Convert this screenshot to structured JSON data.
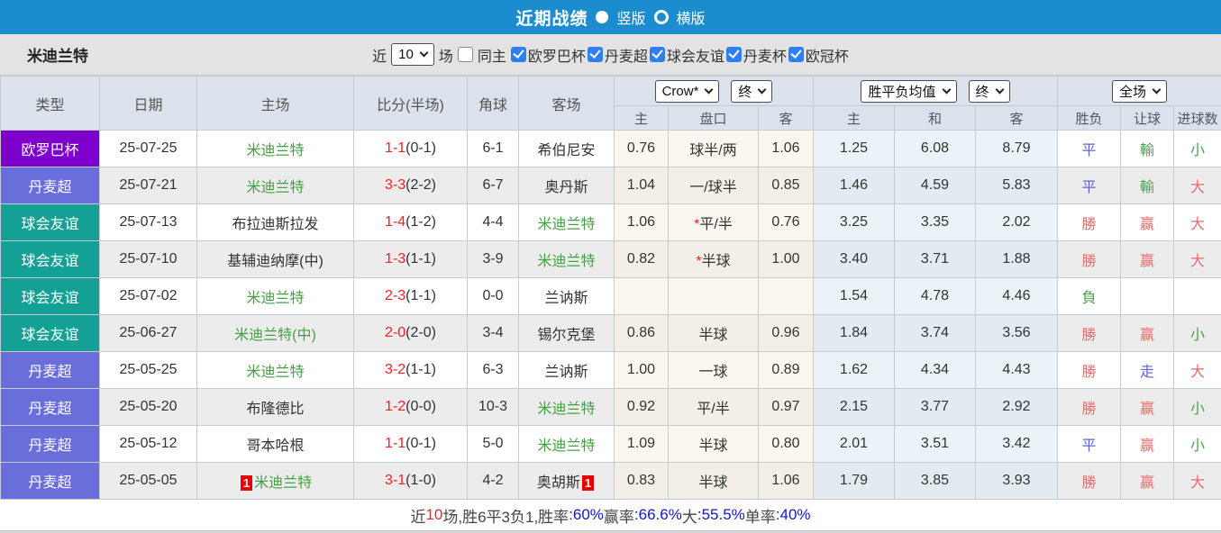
{
  "titlebar": {
    "title": "近期战绩",
    "radio_vertical": "竖版",
    "radio_horizontal": "横版"
  },
  "filterbar": {
    "team": "米迪兰特",
    "near_label": "近",
    "matches_select": "10",
    "matches_label": "场",
    "same_home_label": "同主",
    "same_home_checked": false,
    "leagues": [
      {
        "label": "欧罗巴杯",
        "checked": true
      },
      {
        "label": "丹麦超",
        "checked": true
      },
      {
        "label": "球会友谊",
        "checked": true
      },
      {
        "label": "丹麦杯",
        "checked": true
      },
      {
        "label": "欧冠杯",
        "checked": true
      }
    ]
  },
  "table": {
    "headers": [
      "类型",
      "日期",
      "主场",
      "比分(半场)",
      "角球",
      "客场"
    ],
    "dropdowns": {
      "odds_company": "Crow*",
      "odds_period": "终",
      "avg_metric": "胜平负均值",
      "avg_period": "终",
      "scope": "全场"
    },
    "subheaders": [
      "主",
      "盘口",
      "客",
      "主",
      "和",
      "客",
      "胜负",
      "让球",
      "进球数"
    ],
    "rows": [
      {
        "type": "欧罗巴杯",
        "type_key": "europa",
        "date": "25-07-25",
        "home": {
          "name": "米迪兰特",
          "focus": true,
          "card": ""
        },
        "score": "1-1",
        "half": "(0-1)",
        "corners": "6-1",
        "away": {
          "name": "希伯尼安",
          "focus": false,
          "card": ""
        },
        "odds_home": "0.76",
        "handicap": "球半/两",
        "odds_away": "1.06",
        "avg_win": "1.25",
        "avg_draw": "6.08",
        "avg_lose": "8.79",
        "result": {
          "t": "平",
          "c": "blue"
        },
        "handicap_result": {
          "t": "輸",
          "c": "green"
        },
        "goals": {
          "t": "小",
          "c": "green"
        }
      },
      {
        "type": "丹麦超",
        "type_key": "danish",
        "date": "25-07-21",
        "home": {
          "name": "米迪兰特",
          "focus": true,
          "card": ""
        },
        "score": "3-3",
        "half": "(2-2)",
        "corners": "6-7",
        "away": {
          "name": "奥丹斯",
          "focus": false,
          "card": ""
        },
        "odds_home": "1.04",
        "handicap": "一/球半",
        "odds_away": "0.85",
        "avg_win": "1.46",
        "avg_draw": "4.59",
        "avg_lose": "5.83",
        "result": {
          "t": "平",
          "c": "blue"
        },
        "handicap_result": {
          "t": "輸",
          "c": "green"
        },
        "goals": {
          "t": "大",
          "c": "red"
        }
      },
      {
        "type": "球会友谊",
        "type_key": "friendly",
        "date": "25-07-13",
        "home": {
          "name": "布拉迪斯拉发",
          "focus": false,
          "card": ""
        },
        "score": "1-4",
        "half": "(1-2)",
        "corners": "4-4",
        "away": {
          "name": "米迪兰特",
          "focus": true,
          "card": ""
        },
        "odds_home": "1.06",
        "handicap": "*平/半",
        "odds_away": "0.76",
        "avg_win": "3.25",
        "avg_draw": "3.35",
        "avg_lose": "2.02",
        "result": {
          "t": "勝",
          "c": "red"
        },
        "handicap_result": {
          "t": "赢",
          "c": "red"
        },
        "goals": {
          "t": "大",
          "c": "red"
        }
      },
      {
        "type": "球会友谊",
        "type_key": "friendly",
        "date": "25-07-10",
        "home": {
          "name": "基辅迪纳摩(中)",
          "focus": false,
          "card": ""
        },
        "score": "1-3",
        "half": "(1-1)",
        "corners": "3-9",
        "away": {
          "name": "米迪兰特",
          "focus": true,
          "card": ""
        },
        "odds_home": "0.82",
        "handicap": "*半球",
        "odds_away": "1.00",
        "avg_win": "3.40",
        "avg_draw": "3.71",
        "avg_lose": "1.88",
        "result": {
          "t": "勝",
          "c": "red"
        },
        "handicap_result": {
          "t": "赢",
          "c": "red"
        },
        "goals": {
          "t": "大",
          "c": "red"
        }
      },
      {
        "type": "球会友谊",
        "type_key": "friendly",
        "date": "25-07-02",
        "home": {
          "name": "米迪兰特",
          "focus": true,
          "card": ""
        },
        "score": "2-3",
        "half": "(1-1)",
        "corners": "0-0",
        "away": {
          "name": "兰讷斯",
          "focus": false,
          "card": ""
        },
        "odds_home": "",
        "handicap": "",
        "odds_away": "",
        "avg_win": "1.54",
        "avg_draw": "4.78",
        "avg_lose": "4.46",
        "result": {
          "t": "負",
          "c": "green"
        },
        "handicap_result": {
          "t": "",
          "c": ""
        },
        "goals": {
          "t": "",
          "c": ""
        }
      },
      {
        "type": "球会友谊",
        "type_key": "friendly",
        "date": "25-06-27",
        "home": {
          "name": "米迪兰特(中)",
          "focus": true,
          "card": ""
        },
        "score": "2-0",
        "half": "(2-0)",
        "corners": "3-4",
        "away": {
          "name": "锡尔克堡",
          "focus": false,
          "card": ""
        },
        "odds_home": "0.86",
        "handicap": "半球",
        "odds_away": "0.96",
        "avg_win": "1.84",
        "avg_draw": "3.74",
        "avg_lose": "3.56",
        "result": {
          "t": "勝",
          "c": "red"
        },
        "handicap_result": {
          "t": "赢",
          "c": "red"
        },
        "goals": {
          "t": "小",
          "c": "green"
        }
      },
      {
        "type": "丹麦超",
        "type_key": "danish",
        "date": "25-05-25",
        "home": {
          "name": "米迪兰特",
          "focus": true,
          "card": ""
        },
        "score": "3-2",
        "half": "(1-1)",
        "corners": "6-3",
        "away": {
          "name": "兰讷斯",
          "focus": false,
          "card": ""
        },
        "odds_home": "1.00",
        "handicap": "一球",
        "odds_away": "0.89",
        "avg_win": "1.62",
        "avg_draw": "4.34",
        "avg_lose": "4.43",
        "result": {
          "t": "勝",
          "c": "red"
        },
        "handicap_result": {
          "t": "走",
          "c": "blue"
        },
        "goals": {
          "t": "大",
          "c": "red"
        }
      },
      {
        "type": "丹麦超",
        "type_key": "danish",
        "date": "25-05-20",
        "home": {
          "name": "布隆德比",
          "focus": false,
          "card": ""
        },
        "score": "1-2",
        "half": "(0-0)",
        "corners": "10-3",
        "away": {
          "name": "米迪兰特",
          "focus": true,
          "card": ""
        },
        "odds_home": "0.92",
        "handicap": "平/半",
        "odds_away": "0.97",
        "avg_win": "2.15",
        "avg_draw": "3.77",
        "avg_lose": "2.92",
        "result": {
          "t": "勝",
          "c": "red"
        },
        "handicap_result": {
          "t": "赢",
          "c": "red"
        },
        "goals": {
          "t": "小",
          "c": "green"
        }
      },
      {
        "type": "丹麦超",
        "type_key": "danish",
        "date": "25-05-12",
        "home": {
          "name": "哥本哈根",
          "focus": false,
          "card": ""
        },
        "score": "1-1",
        "half": "(0-1)",
        "corners": "5-0",
        "away": {
          "name": "米迪兰特",
          "focus": true,
          "card": ""
        },
        "odds_home": "1.09",
        "handicap": "半球",
        "odds_away": "0.80",
        "avg_win": "2.01",
        "avg_draw": "3.51",
        "avg_lose": "3.42",
        "result": {
          "t": "平",
          "c": "blue"
        },
        "handicap_result": {
          "t": "赢",
          "c": "red"
        },
        "goals": {
          "t": "小",
          "c": "green"
        }
      },
      {
        "type": "丹麦超",
        "type_key": "danish",
        "date": "25-05-05",
        "home": {
          "name": "米迪兰特",
          "focus": true,
          "card": "1"
        },
        "score": "3-1",
        "half": "(1-0)",
        "corners": "4-2",
        "away": {
          "name": "奥胡斯",
          "focus": false,
          "card": "1"
        },
        "odds_home": "0.83",
        "handicap": "半球",
        "odds_away": "1.06",
        "avg_win": "1.79",
        "avg_draw": "3.85",
        "avg_lose": "3.93",
        "result": {
          "t": "勝",
          "c": "red"
        },
        "handicap_result": {
          "t": "赢",
          "c": "red"
        },
        "goals": {
          "t": "大",
          "c": "red"
        }
      }
    ]
  },
  "footer": {
    "segments": [
      {
        "text": "近",
        "c": "dark"
      },
      {
        "text": "10",
        "c": "red"
      },
      {
        "text": "场,胜6平3负1, ",
        "c": "dark"
      },
      {
        "text": "胜率",
        "c": "dark"
      },
      {
        "text": ":60%",
        "c": "blue"
      },
      {
        "text": " 赢率",
        "c": "dark"
      },
      {
        "text": ":66.6%",
        "c": "blue"
      },
      {
        "text": " 大",
        "c": "dark"
      },
      {
        "text": ":55.5%",
        "c": "blue"
      },
      {
        "text": " 单率",
        "c": "dark"
      },
      {
        "text": ":40%",
        "c": "blue"
      }
    ]
  },
  "colors": {
    "europa": "#7d00cc",
    "danish": "#6a6edb",
    "friendly": "#14a095",
    "titlebar_blue": "#1b8ccd",
    "checkbox_blue": "#2e7ff0",
    "score_red": "#fa1e1e",
    "team_green": "#43a043",
    "result_red": "#e96a6a",
    "result_blue": "#6161d8",
    "result_green": "#4f9e50",
    "stat_blue": "#1414d8"
  }
}
